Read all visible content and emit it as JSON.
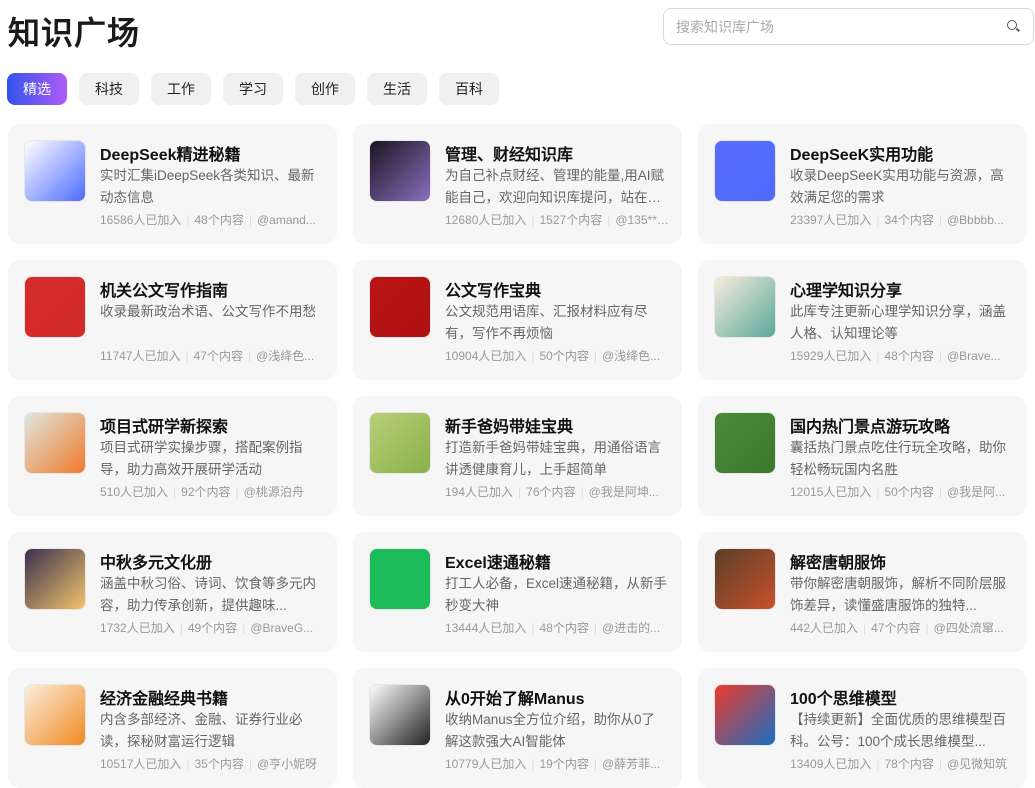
{
  "header": {
    "title": "知识广场",
    "search_placeholder": "搜索知识库广场"
  },
  "tabs": [
    {
      "label": "精选",
      "active": true
    },
    {
      "label": "科技"
    },
    {
      "label": "工作"
    },
    {
      "label": "学习"
    },
    {
      "label": "创作"
    },
    {
      "label": "生活"
    },
    {
      "label": "百科"
    }
  ],
  "cards": [
    {
      "title": "DeepSeek精进秘籍",
      "desc": "实时汇集iDeepSeek各类知识、最新动态信息",
      "joined": "16586人已加入",
      "count": "48个内容",
      "author": "@amand...",
      "icon": "deepseek-whale-icon",
      "color": "#4d6bfe",
      "bg": "#ffffff"
    },
    {
      "title": "管理、财经知识库",
      "desc": "为自己补点财经、管理的能量,用AI赋能自己，欢迎向知识库提问，站在巨...",
      "joined": "12680人已加入",
      "count": "1527个内容",
      "author": "@135***...",
      "icon": "night-tree-photo-icon",
      "color": "#8a6fbf",
      "bg": "#1a1420"
    },
    {
      "title": "DeepSeeK实用功能",
      "desc": "收录DeepSeeK实用功能与资源，高效满足您的需求",
      "joined": "23397人已加入",
      "count": "34个内容",
      "author": "@Bbbbb...",
      "icon": "deepseek-whale-icon",
      "color": "#4d6bfe",
      "bg": "#5a6cff"
    },
    {
      "title": "机关公文写作指南",
      "desc": "收录最新政治术语、公文写作不用愁",
      "joined": "11747人已加入",
      "count": "47个内容",
      "author": "@浅绛色...",
      "icon": "document-writing-icon",
      "color": "#d32a2a",
      "bg": "#d42b2b"
    },
    {
      "title": "公文写作宝典",
      "desc": "公文规范用语库、汇报材料应有尽有，写作不再烦恼",
      "joined": "10904人已加入",
      "count": "50个内容",
      "author": "@浅绛色...",
      "icon": "document-book-icon",
      "color": "#b01010",
      "bg": "#b81515"
    },
    {
      "title": "心理学知识分享",
      "desc": "此库专注更新心理学知识分享，涵盖人格、认知理论等",
      "joined": "15929人已加入",
      "count": "48个内容",
      "author": "@Brave...",
      "icon": "psychology-chart-icon",
      "color": "#5aa89a",
      "bg": "#f7ecdc"
    },
    {
      "title": "项目式研学新探索",
      "desc": "项目式研学实操步骤，搭配案例指导，助力高效开展研学活动",
      "joined": "510人已加入",
      "count": "92个内容",
      "author": "@桃源泊舟",
      "icon": "leaf-study-icon",
      "color": "#f07a2a",
      "bg": "#dfe6df"
    },
    {
      "title": "新手爸妈带娃宝典",
      "desc": "打造新手爸妈带娃宝典，用通俗语言讲透健康育儿，上手超简单",
      "joined": "194人已加入",
      "count": "76个内容",
      "author": "@我是阿坤...",
      "icon": "family-park-icon",
      "color": "#8ab04a",
      "bg": "#b9cf7a"
    },
    {
      "title": "国内热门景点游玩攻略",
      "desc": "囊括热门景点吃住行玩全攻略，助你轻松畅玩国内名胜",
      "joined": "12015人已加入",
      "count": "50个内容",
      "author": "@我是阿...",
      "icon": "great-wall-photo-icon",
      "color": "#3a7a2a",
      "bg": "#4a8a3a"
    },
    {
      "title": "中秋多元文化册",
      "desc": "涵盖中秋习俗、诗词、饮食等多元内容，助力传承创新，提供趣味...",
      "joined": "1732人已加入",
      "count": "49个内容",
      "author": "@BraveG...",
      "icon": "mid-autumn-moon-icon",
      "color": "#f3c46a",
      "bg": "#3a3050"
    },
    {
      "title": "Excel速通秘籍",
      "desc": "打工人必备，Excel速通秘籍，从新手秒变大神",
      "joined": "13444人已加入",
      "count": "48个内容",
      "author": "@进击的...",
      "icon": "excel-icon",
      "color": "#1dbb5a",
      "bg": "#1dbb5a"
    },
    {
      "title": "解密唐朝服饰",
      "desc": "带你解密唐朝服饰，解析不同阶层服饰差异，读懂盛唐服饰的独特...",
      "joined": "442人已加入",
      "count": "47个内容",
      "author": "@四处流窜...",
      "icon": "tang-costume-painting-icon",
      "color": "#c8502a",
      "bg": "#5a4028"
    },
    {
      "title": "经济金融经典书籍",
      "desc": "内含多部经济、金融、证券行业必读，探秘财富运行逻辑",
      "joined": "10517人已加入",
      "count": "35个内容",
      "author": "@亨小妮呀",
      "icon": "finance-chart-icon",
      "color": "#f08a20",
      "bg": "#fbeedd"
    },
    {
      "title": "从0开始了解Manus",
      "desc": "收纳Manus全方位介绍，助你从0了解这款强大AI智能体",
      "joined": "10779人已加入",
      "count": "19个内容",
      "author": "@薛芳菲...",
      "icon": "manus-hand-icon",
      "color": "#222222",
      "bg": "#ffffff"
    },
    {
      "title": "100个思维模型",
      "desc": "【持续更新】全面优质的思维模型百科。公号：100个成长思维模型...",
      "joined": "13409人已加入",
      "count": "78个内容",
      "author": "@见微知筑",
      "icon": "thinking-person-icon",
      "color": "#1a6fc4",
      "bg": "#ec3a2a"
    }
  ]
}
